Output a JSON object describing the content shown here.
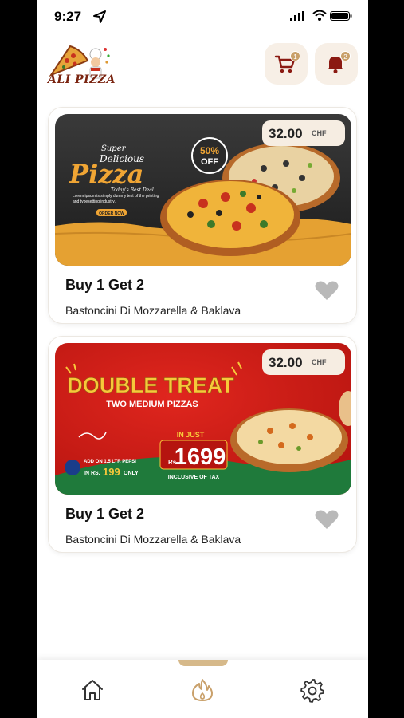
{
  "status": {
    "time": "9:27"
  },
  "header": {
    "logo_text": "ALI PIZZA",
    "cart_badge": "1",
    "bell_badge": "2"
  },
  "offers": [
    {
      "price": "32.00",
      "currency": "CHF",
      "title": "Buy 1 Get 2",
      "subtitle": "Bastoncini Di Mozzarella & Baklava",
      "banner": {
        "line1": "Super",
        "line2": "Delicious",
        "line3": "Pizza",
        "line4": "Today's Best Deal",
        "badge_top": "50%",
        "badge_bottom": "OFF",
        "body": "Lorem ipsum is simply dummy text of the printing and typesetting industry.",
        "cta": "ORDER NOW"
      }
    },
    {
      "price": "32.00",
      "currency": "CHF",
      "title": "Buy 1 Get 2",
      "subtitle": "Bastoncini Di Mozzarella & Baklava",
      "banner": {
        "headline": "DOUBLE TREAT",
        "subhead": "TWO MEDIUM PIZZAS",
        "injust": "IN JUST",
        "rs": "Rs.",
        "price": "1699",
        "tax": "INCLUSIVE OF TAX",
        "addon1": "ADD ON 1.5 LTR PEPSI",
        "addon2": "IN RS.",
        "addon3": "199",
        "addon4": "ONLY"
      }
    }
  ],
  "colors": {
    "accent": "#d6b98a",
    "cart_icon": "#8b1a12",
    "heart": "#b9b9b9",
    "badge": "#c9a06a"
  }
}
